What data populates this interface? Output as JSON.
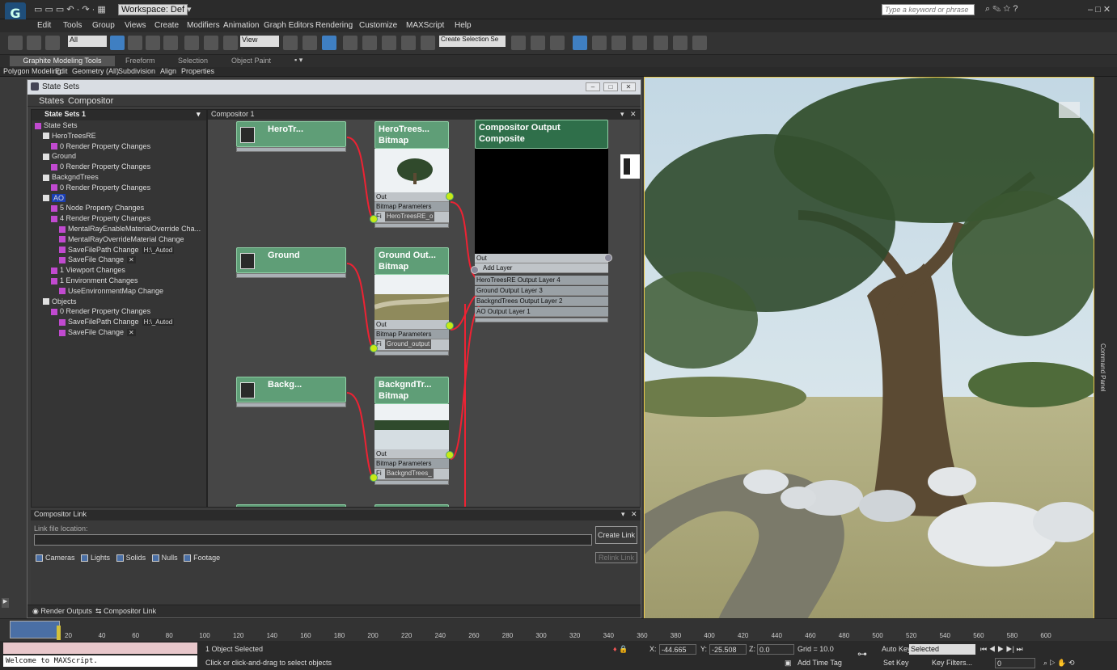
{
  "titlebar": {
    "workspace": "Workspace: Def",
    "search_placeholder": "Type a keyword or phrase",
    "window_controls": "– □ ✕"
  },
  "menu": [
    "Edit",
    "Tools",
    "Group",
    "Views",
    "Create",
    "Modifiers",
    "Animation",
    "Graph Editors",
    "Rendering",
    "Customize",
    "MAXScript",
    "Help"
  ],
  "toolbar": {
    "selection_filter": "All",
    "ref_coord": "View",
    "named_selection": "Create Selection Se"
  },
  "ribbon": {
    "tabs": [
      "Graphite Modeling Tools",
      "Freeform",
      "Selection",
      "Object Paint"
    ],
    "subtabs": [
      "Polygon Modeling",
      "Edit",
      "Geometry (All)",
      "Subdivision",
      "Align",
      "Properties"
    ]
  },
  "state_sets": {
    "window_title": "State Sets",
    "menu": [
      "States",
      "Compositor"
    ],
    "tree_header": "State Sets 1",
    "tree": [
      {
        "indent": 0,
        "label": "State Sets"
      },
      {
        "indent": 1,
        "label": "HeroTreesRE"
      },
      {
        "indent": 2,
        "label": "0 Render Property Changes"
      },
      {
        "indent": 1,
        "label": "Ground"
      },
      {
        "indent": 2,
        "label": "0 Render Property Changes"
      },
      {
        "indent": 1,
        "label": "BackgndTrees"
      },
      {
        "indent": 2,
        "label": "0 Render Property Changes"
      },
      {
        "indent": 1,
        "label": "AO",
        "selected": true
      },
      {
        "indent": 2,
        "label": "5 Node Property Changes"
      },
      {
        "indent": 2,
        "label": "4 Render Property Changes"
      },
      {
        "indent": 3,
        "label": "MentalRayEnableMaterialOverride Cha..."
      },
      {
        "indent": 3,
        "label": "MentalRayOverrideMaterial Change"
      },
      {
        "indent": 3,
        "label": "SaveFilePath Change",
        "extra": "H:\\_Autod"
      },
      {
        "indent": 3,
        "label": "SaveFile Change",
        "extra": "✕"
      },
      {
        "indent": 2,
        "label": "1 Viewport Changes"
      },
      {
        "indent": 2,
        "label": "1 Environment Changes"
      },
      {
        "indent": 3,
        "label": "UseEnvironmentMap Change"
      },
      {
        "indent": 1,
        "label": "Objects"
      },
      {
        "indent": 2,
        "label": "0 Render Property Changes"
      },
      {
        "indent": 3,
        "label": "SaveFilePath Change",
        "extra": "H:\\_Autod"
      },
      {
        "indent": 3,
        "label": "SaveFile Change",
        "extra": "✕"
      }
    ],
    "compositor_title": "Compositor 1",
    "nodes": {
      "hero_state": "HeroTr...",
      "hero_bitmap": "HeroTrees...",
      "hero_bitmap_sub": "Bitmap",
      "hero_file": "HeroTreesRE_o",
      "ground_state": "Ground",
      "ground_bitmap": "Ground Out...",
      "ground_bitmap_sub": "Bitmap",
      "ground_file": "Ground_output",
      "back_state": "Backg...",
      "back_bitmap": "BackgndTr...",
      "back_bitmap_sub": "Bitmap",
      "back_file": "BackgndTrees_",
      "out_label": "Out",
      "params_label": "Bitmap Parameters",
      "fi_label": "Fi",
      "composite_title": "Compositor Output",
      "composite_sub": "Composite",
      "composite_out": "Out",
      "add_layer": "Add Layer",
      "layers": [
        "HeroTreesRE Output Layer 4",
        "Ground Output Layer 3",
        "BackgndTrees Output Layer 2",
        "AO Output Layer 1"
      ]
    },
    "link_panel": {
      "title": "Compositor Link",
      "location_label": "Link file location:",
      "create_btn": "Create Link",
      "relink_btn": "Relink Link",
      "checks": [
        "Cameras",
        "Lights",
        "Solids",
        "Nulls",
        "Footage"
      ]
    },
    "bottom_tabs": [
      "Render Outputs",
      "Compositor Link"
    ]
  },
  "viewport": {
    "command_panel_label": "Command Panel"
  },
  "timeline": {
    "ticks": [
      "20",
      "40",
      "60",
      "80",
      "100",
      "120",
      "140",
      "160",
      "180",
      "200",
      "220",
      "240",
      "260",
      "280",
      "300",
      "320",
      "340",
      "360",
      "380",
      "400",
      "420",
      "440",
      "460",
      "480",
      "500",
      "520",
      "540",
      "560",
      "580",
      "600"
    ]
  },
  "status": {
    "maxscript": "Welcome to MAXScript.",
    "selected": "1 Object Selected",
    "prompt": "Click or click-and-drag to select objects",
    "x_label": "X:",
    "x": "-44.665",
    "y_label": "Y:",
    "y": "-25.508",
    "z_label": "Z:",
    "z": "0.0",
    "grid": "Grid = 10.0",
    "add_time_tag": "Add Time Tag",
    "auto_key": "Auto Key",
    "auto_key_value": "Selected",
    "set_key": "Set Key",
    "key_filters": "Key Filters...",
    "frame": "0"
  }
}
